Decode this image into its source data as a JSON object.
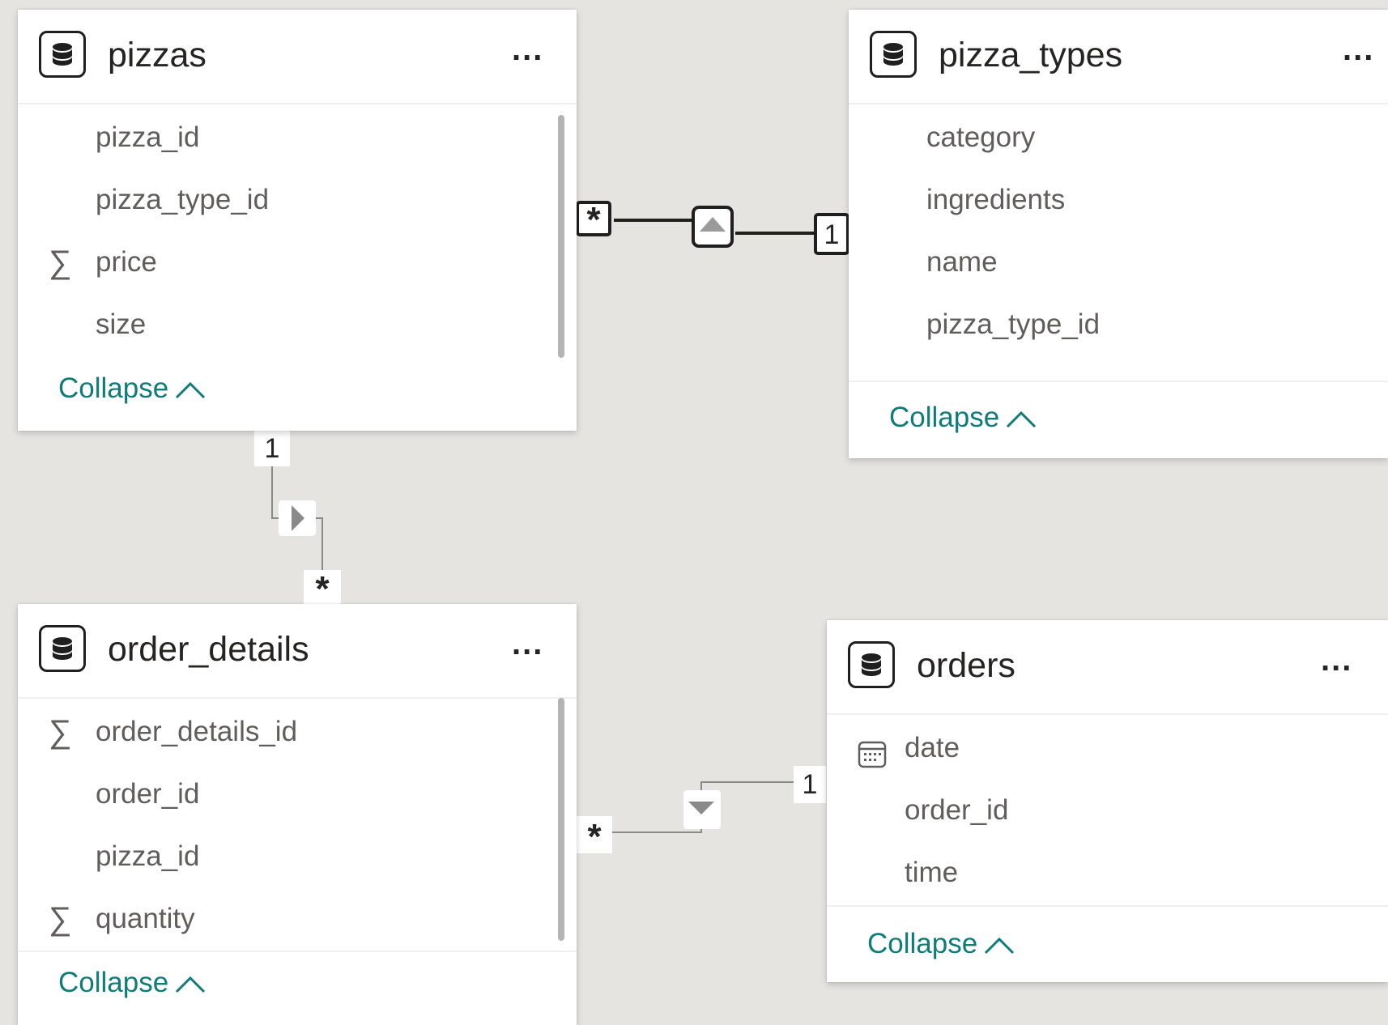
{
  "tables": {
    "pizzas": {
      "title": "pizzas",
      "fields": [
        {
          "name": "pizza_id",
          "icon": ""
        },
        {
          "name": "pizza_type_id",
          "icon": ""
        },
        {
          "name": "price",
          "icon": "sum-icon"
        },
        {
          "name": "size",
          "icon": ""
        }
      ],
      "collapse_label": "Collapse"
    },
    "pizza_types": {
      "title": "pizza_types",
      "fields": [
        {
          "name": "category",
          "icon": ""
        },
        {
          "name": "ingredients",
          "icon": ""
        },
        {
          "name": "name",
          "icon": ""
        },
        {
          "name": "pizza_type_id",
          "icon": ""
        }
      ],
      "collapse_label": "Collapse"
    },
    "order_details": {
      "title": "order_details",
      "fields": [
        {
          "name": "order_details_id",
          "icon": "sum-icon"
        },
        {
          "name": "order_id",
          "icon": ""
        },
        {
          "name": "pizza_id",
          "icon": ""
        },
        {
          "name": "quantity",
          "icon": "sum-icon"
        }
      ],
      "collapse_label": "Collapse"
    },
    "orders": {
      "title": "orders",
      "fields": [
        {
          "name": "date",
          "icon": "calendar-icon"
        },
        {
          "name": "order_id",
          "icon": ""
        },
        {
          "name": "time",
          "icon": ""
        }
      ],
      "collapse_label": "Collapse"
    }
  },
  "relationships": {
    "pizzas_pizza_types": {
      "from_card": "*",
      "to_card": "1"
    },
    "pizzas_order_details": {
      "from_card": "1",
      "to_card": "*"
    },
    "order_details_orders": {
      "from_card": "*",
      "to_card": "1"
    }
  },
  "more_label": "...",
  "colors": {
    "canvas": "#e6e4e1",
    "card": "#ffffff",
    "collapse": "#107c79",
    "text": "#605e5c"
  }
}
